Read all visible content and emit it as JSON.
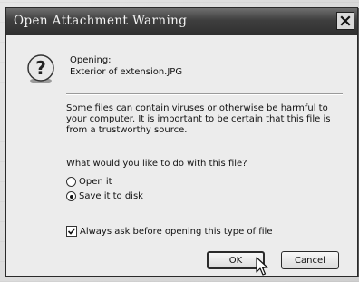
{
  "window": {
    "title": "Open Attachment Warning",
    "close_icon": "close-icon"
  },
  "info": {
    "icon": "question-icon",
    "opening_label": "Opening:",
    "filename": "Exterior of extension.JPG"
  },
  "warning_text": "Some files can contain viruses or otherwise be harmful to your computer. It is important to be certain that this file is from a trustworthy source.",
  "question": "What would you like to do with this file?",
  "options": [
    {
      "label": "Open it",
      "selected": false
    },
    {
      "label": "Save it to disk",
      "selected": true
    }
  ],
  "always_ask": {
    "label": "Always ask before opening this type of file",
    "checked": true
  },
  "buttons": {
    "ok": "OK",
    "cancel": "Cancel"
  }
}
